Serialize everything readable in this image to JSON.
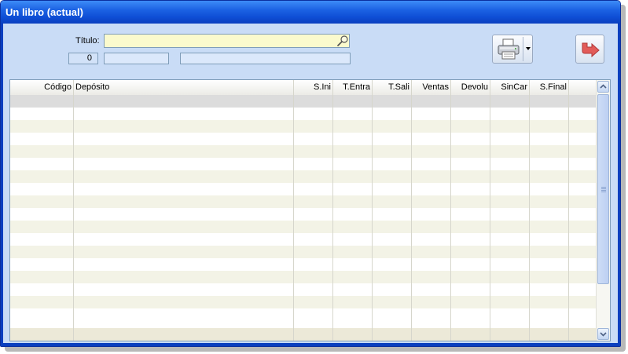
{
  "window": {
    "title": "Un libro (actual)"
  },
  "form": {
    "titulo_label": "Título:",
    "titulo_value": "",
    "count": "0",
    "info1": "",
    "info2": ""
  },
  "toolbar": {
    "print_icon": "printer-icon",
    "dropdown_icon": "chevron-down-icon",
    "exit_icon": "exit-arrow-icon"
  },
  "table": {
    "columns": [
      "Código",
      "Depósito",
      "S.Ini",
      "T.Entra",
      "T.Sali",
      "Ventas",
      "Devolu",
      "SinCar",
      "S.Final"
    ],
    "rows": []
  },
  "colors": {
    "titlebar": "#1c62e3",
    "window_bg": "#c9dcf6",
    "input_bg": "#fafacd",
    "row_alt": "#f3f3e6",
    "exit_arrow": "#e25b58"
  }
}
